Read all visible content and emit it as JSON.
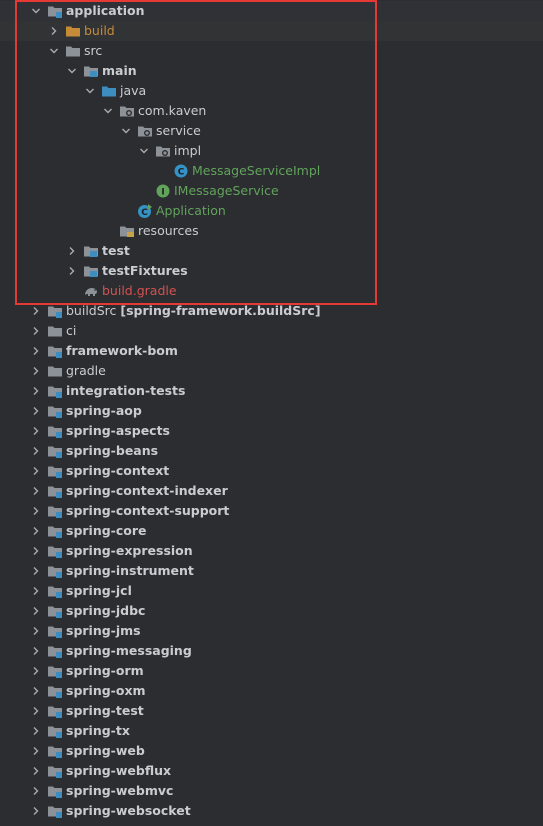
{
  "tree": [
    {
      "label": "application",
      "depth": 0,
      "expand": "open",
      "icon": "module-folder-icon",
      "style": "bold",
      "selected": true
    },
    {
      "label": "build",
      "depth": 1,
      "expand": "closed",
      "icon": "folder-orange-icon",
      "style": "build",
      "hl": true
    },
    {
      "label": "src",
      "depth": 1,
      "expand": "open",
      "icon": "folder-icon",
      "style": "default"
    },
    {
      "label": "main",
      "depth": 2,
      "expand": "open",
      "icon": "source-root-folder-icon",
      "style": "bold"
    },
    {
      "label": "java",
      "depth": 3,
      "expand": "open",
      "icon": "java-source-folder-icon",
      "style": "default"
    },
    {
      "label": "com.kaven",
      "depth": 4,
      "expand": "open",
      "icon": "package-icon",
      "style": "default"
    },
    {
      "label": "service",
      "depth": 5,
      "expand": "open",
      "icon": "package-icon",
      "style": "default"
    },
    {
      "label": "impl",
      "depth": 6,
      "expand": "open",
      "icon": "package-icon",
      "style": "default"
    },
    {
      "label": "MessageServiceImpl",
      "depth": 7,
      "expand": "none",
      "icon": "java-class-icon",
      "style": "java"
    },
    {
      "label": "IMessageService",
      "depth": 6,
      "expand": "none",
      "icon": "java-interface-icon",
      "style": "java"
    },
    {
      "label": "Application",
      "depth": 5,
      "expand": "none",
      "icon": "java-main-class-icon",
      "style": "java"
    },
    {
      "label": "resources",
      "depth": 4,
      "expand": "none",
      "icon": "resources-folder-icon",
      "style": "default"
    },
    {
      "label": "test",
      "depth": 2,
      "expand": "closed",
      "icon": "source-root-folder-icon",
      "style": "bold"
    },
    {
      "label": "testFixtures",
      "depth": 2,
      "expand": "closed",
      "icon": "source-root-folder-icon",
      "style": "bold"
    },
    {
      "label": "build.gradle",
      "depth": 2,
      "expand": "none",
      "icon": "gradle-elephant-icon",
      "style": "gradle"
    },
    {
      "label": "buildSrc [spring-framework.buildSrc]",
      "depth": 0,
      "expand": "closed",
      "icon": "module-folder-icon",
      "style": "buildsrc"
    },
    {
      "label": "ci",
      "depth": 0,
      "expand": "closed",
      "icon": "folder-icon",
      "style": "default"
    },
    {
      "label": "framework-bom",
      "depth": 0,
      "expand": "closed",
      "icon": "module-folder-icon",
      "style": "bold"
    },
    {
      "label": "gradle",
      "depth": 0,
      "expand": "closed",
      "icon": "folder-icon",
      "style": "default"
    },
    {
      "label": "integration-tests",
      "depth": 0,
      "expand": "closed",
      "icon": "module-folder-icon",
      "style": "bold"
    },
    {
      "label": "spring-aop",
      "depth": 0,
      "expand": "closed",
      "icon": "module-folder-icon",
      "style": "bold"
    },
    {
      "label": "spring-aspects",
      "depth": 0,
      "expand": "closed",
      "icon": "module-folder-icon",
      "style": "bold"
    },
    {
      "label": "spring-beans",
      "depth": 0,
      "expand": "closed",
      "icon": "module-folder-icon",
      "style": "bold"
    },
    {
      "label": "spring-context",
      "depth": 0,
      "expand": "closed",
      "icon": "module-folder-icon",
      "style": "bold"
    },
    {
      "label": "spring-context-indexer",
      "depth": 0,
      "expand": "closed",
      "icon": "module-folder-icon",
      "style": "bold"
    },
    {
      "label": "spring-context-support",
      "depth": 0,
      "expand": "closed",
      "icon": "module-folder-icon",
      "style": "bold"
    },
    {
      "label": "spring-core",
      "depth": 0,
      "expand": "closed",
      "icon": "module-folder-icon",
      "style": "bold"
    },
    {
      "label": "spring-expression",
      "depth": 0,
      "expand": "closed",
      "icon": "module-folder-icon",
      "style": "bold"
    },
    {
      "label": "spring-instrument",
      "depth": 0,
      "expand": "closed",
      "icon": "module-folder-icon",
      "style": "bold"
    },
    {
      "label": "spring-jcl",
      "depth": 0,
      "expand": "closed",
      "icon": "module-folder-icon",
      "style": "bold"
    },
    {
      "label": "spring-jdbc",
      "depth": 0,
      "expand": "closed",
      "icon": "module-folder-icon",
      "style": "bold"
    },
    {
      "label": "spring-jms",
      "depth": 0,
      "expand": "closed",
      "icon": "module-folder-icon",
      "style": "bold"
    },
    {
      "label": "spring-messaging",
      "depth": 0,
      "expand": "closed",
      "icon": "module-folder-icon",
      "style": "bold"
    },
    {
      "label": "spring-orm",
      "depth": 0,
      "expand": "closed",
      "icon": "module-folder-icon",
      "style": "bold"
    },
    {
      "label": "spring-oxm",
      "depth": 0,
      "expand": "closed",
      "icon": "module-folder-icon",
      "style": "bold"
    },
    {
      "label": "spring-test",
      "depth": 0,
      "expand": "closed",
      "icon": "module-folder-icon",
      "style": "bold"
    },
    {
      "label": "spring-tx",
      "depth": 0,
      "expand": "closed",
      "icon": "module-folder-icon",
      "style": "bold"
    },
    {
      "label": "spring-web",
      "depth": 0,
      "expand": "closed",
      "icon": "module-folder-icon",
      "style": "bold"
    },
    {
      "label": "spring-webflux",
      "depth": 0,
      "expand": "closed",
      "icon": "module-folder-icon",
      "style": "bold"
    },
    {
      "label": "spring-webmvc",
      "depth": 0,
      "expand": "closed",
      "icon": "module-folder-icon",
      "style": "bold"
    },
    {
      "label": "spring-websocket",
      "depth": 0,
      "expand": "closed",
      "icon": "module-folder-icon",
      "style": "bold"
    }
  ],
  "colors": {
    "background": "#2b2d30",
    "highlight_border": "#e53935",
    "build_folder": "#c58b37",
    "java_file": "#62a35c",
    "gradle_file": "#d25252",
    "folder": "#8c9297",
    "source_root": "#3d8ebf"
  }
}
